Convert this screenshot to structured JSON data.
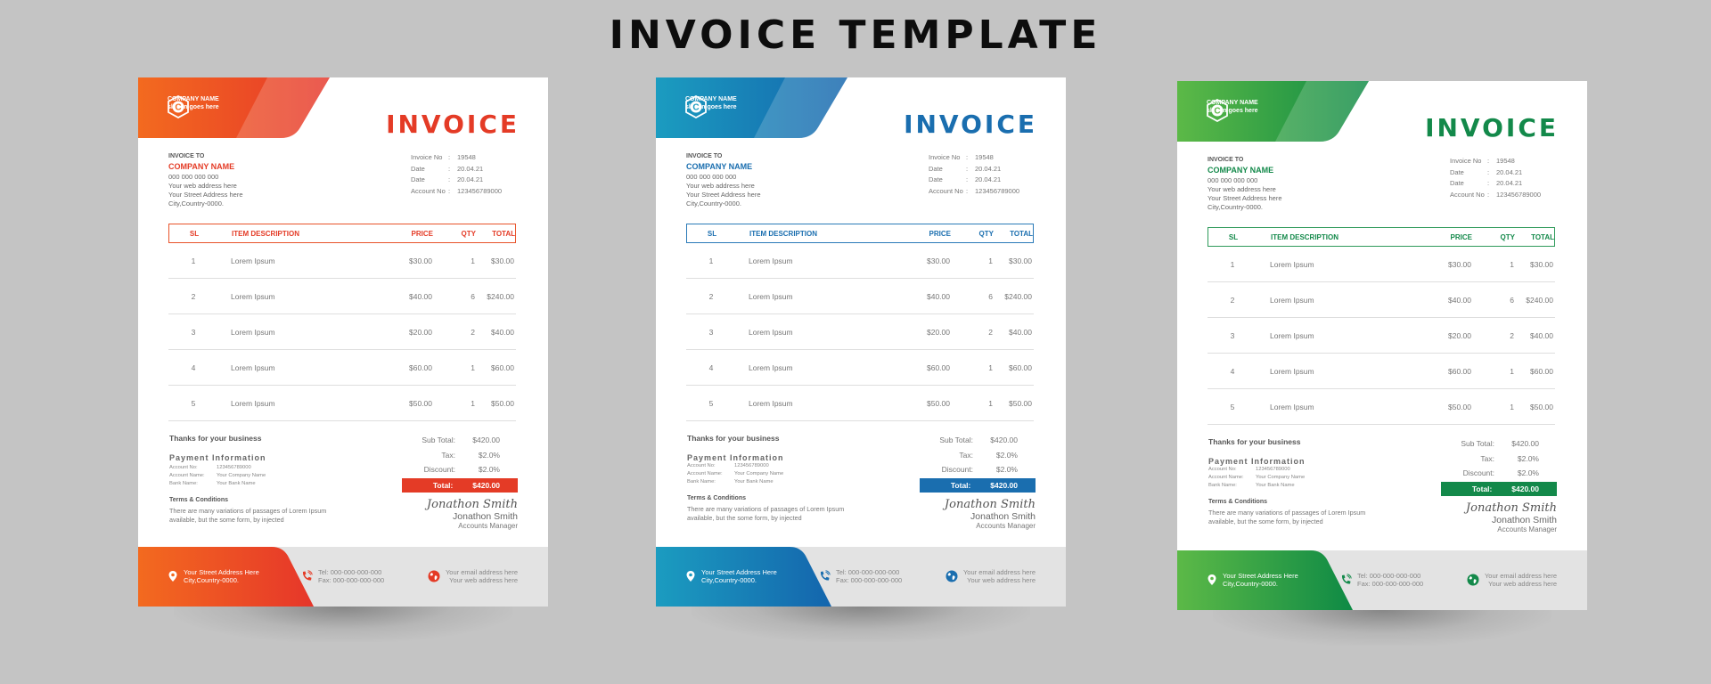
{
  "page_title": "INVOICE TEMPLATE",
  "invoices": [
    {
      "theme": "orange",
      "colors": {
        "accent": "#e43b26",
        "grad_start": "#f36a1f",
        "grad_end": "#e6362a",
        "header_border": "#e8532a"
      },
      "logo": {
        "letter": "C",
        "company": "COMPANY NAME",
        "slogan": "slogan goes here"
      },
      "title": "INVOICE",
      "bill_to": {
        "label": "INVOICE TO",
        "company": "COMPANY NAME",
        "phone": "000 000 000 000",
        "web": "Your web address here",
        "street": "Your Street Address here",
        "city": "City,Country-0000."
      },
      "meta": [
        {
          "key": "Invoice No",
          "sep": ":",
          "value": "19548"
        },
        {
          "key": "Date",
          "sep": ":",
          "value": "20.04.21"
        },
        {
          "key": "Date",
          "sep": ":",
          "value": "20.04.21"
        },
        {
          "key": "Account No",
          "sep": ":",
          "value": "123456789000"
        }
      ]
    },
    {
      "theme": "blue",
      "colors": {
        "accent": "#1a6eaf",
        "grad_start": "#1b9cc0",
        "grad_end": "#1465ad",
        "header_border": "#2a7ab8"
      },
      "logo": {
        "letter": "C",
        "company": "COMPANY NAME",
        "slogan": "slogan goes here"
      },
      "title": "INVOICE",
      "bill_to": {
        "label": "INVOICE TO",
        "company": "COMPANY NAME",
        "phone": "000 000 000 000",
        "web": "Your web address here",
        "street": "Your Street Address here",
        "city": "City,Country-0000."
      },
      "meta": [
        {
          "key": "Invoice No",
          "sep": ":",
          "value": "19548"
        },
        {
          "key": "Date",
          "sep": ":",
          "value": "20.04.21"
        },
        {
          "key": "Date",
          "sep": ":",
          "value": "20.04.21"
        },
        {
          "key": "Account No",
          "sep": ":",
          "value": "123456789000"
        }
      ]
    },
    {
      "theme": "green",
      "colors": {
        "accent": "#13894a",
        "grad_start": "#5cb947",
        "grad_end": "#0e8a45",
        "header_border": "#2e9a5a"
      },
      "logo": {
        "letter": "C",
        "company": "COMPANY NAME",
        "slogan": "slogan goes here"
      },
      "title": "INVOICE",
      "bill_to": {
        "label": "INVOICE TO",
        "company": "COMPANY NAME",
        "phone": "000 000 000 000",
        "web": "Your web address here",
        "street": "Your Street Address here",
        "city": "City,Country-0000."
      },
      "meta": [
        {
          "key": "Invoice No",
          "sep": ":",
          "value": "19548"
        },
        {
          "key": "Date",
          "sep": ":",
          "value": "20.04.21"
        },
        {
          "key": "Date",
          "sep": ":",
          "value": "20.04.21"
        },
        {
          "key": "Account No",
          "sep": ":",
          "value": "123456789000"
        }
      ]
    }
  ],
  "table": {
    "headers": {
      "sl": "SL",
      "desc": "ITEM DESCRIPTION",
      "price": "PRICE",
      "qty": "QTY",
      "total": "TOTAL"
    },
    "rows": [
      {
        "sl": "1",
        "desc": "Lorem Ipsum",
        "price": "$30.00",
        "qty": "1",
        "total": "$30.00"
      },
      {
        "sl": "2",
        "desc": "Lorem Ipsum",
        "price": "$40.00",
        "qty": "6",
        "total": "$240.00"
      },
      {
        "sl": "3",
        "desc": "Lorem Ipsum",
        "price": "$20.00",
        "qty": "2",
        "total": "$40.00"
      },
      {
        "sl": "4",
        "desc": "Lorem Ipsum",
        "price": "$60.00",
        "qty": "1",
        "total": "$60.00"
      },
      {
        "sl": "5",
        "desc": "Lorem Ipsum",
        "price": "$50.00",
        "qty": "1",
        "total": "$50.00"
      }
    ]
  },
  "summary": {
    "thanks": "Thanks for your business",
    "payment_title": "Payment Information",
    "payment": [
      {
        "key": "Account No:",
        "value": "123456789000"
      },
      {
        "key": "Account Name:",
        "value": "Your Company Name"
      },
      {
        "key": "Bank Name:",
        "value": "Your Bank Name"
      }
    ],
    "terms_title": "Terms & Conditions",
    "terms_text": "There are many variations of passages of Lorem Ipsum available, but the some form, by injected",
    "totals": [
      {
        "key": "Sub Total:",
        "value": "$420.00"
      },
      {
        "key": "Tax:",
        "value": "$2.0%"
      },
      {
        "key": "Discount:",
        "value": "$2.0%"
      }
    ],
    "grand_total": {
      "key": "Total:",
      "value": "$420.00"
    },
    "signature_script": "Jonathon Smith",
    "signature_name": "Jonathon  Smith",
    "signature_role": "Accounts Manager"
  },
  "footer": {
    "address_line1": "Your Street Address Here",
    "address_line2": "City,Country-0000.",
    "tel": "Tel:   000-000-000-000",
    "fax": "Fax:  000-000-000-000",
    "email": "Your email address here",
    "web": "Your web address here"
  }
}
